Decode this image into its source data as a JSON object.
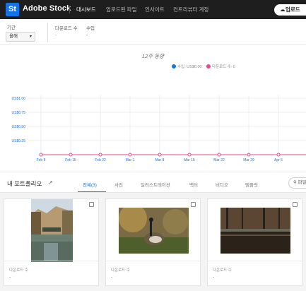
{
  "app": {
    "logo": "St",
    "brand": "Adobe Stock",
    "nav": [
      {
        "label": "대시보드",
        "active": true
      },
      {
        "label": "업로드된 파일",
        "active": false
      },
      {
        "label": "인사이트",
        "active": false
      },
      {
        "label": "컨트리뷰터 계정",
        "active": false
      }
    ],
    "upload_label": "업로드"
  },
  "filters": {
    "period_label": "기간",
    "period_value": "올해",
    "downloads_label": "다운로드 수",
    "downloads_value": "-",
    "revenue_label": "수입",
    "revenue_value": "-"
  },
  "chart_data": {
    "type": "line",
    "title": "12주 동향",
    "legend": [
      {
        "name": "수입: US$0.00",
        "color": "#1473e6"
      },
      {
        "name": "다운로드 수: 0",
        "color": "#e8488a"
      }
    ],
    "y_tick_labels": [
      "US$1.00",
      "US$0.75",
      "US$0.50",
      "US$0.25"
    ],
    "ylim": [
      0,
      1
    ],
    "categories": [
      "Feb 8",
      "Feb 15",
      "Feb 22",
      "Mar 1",
      "Mar 8",
      "Mar 15",
      "Mar 22",
      "Mar 29",
      "Apr 5",
      "Ap"
    ],
    "series": [
      {
        "name": "다운로드 수",
        "values": [
          0,
          0,
          0,
          0,
          0,
          0,
          0,
          0,
          0,
          0
        ],
        "color": "#e8488a"
      }
    ],
    "grid": true,
    "legend_position": "top"
  },
  "portfolio": {
    "title": "내 포트폴리오",
    "tabs": [
      {
        "label": "전체(3)",
        "active": true
      },
      {
        "label": "사진",
        "active": false
      },
      {
        "label": "일러스트레이션",
        "active": false
      },
      {
        "label": "벡터",
        "active": false
      },
      {
        "label": "비디오",
        "active": false
      },
      {
        "label": "템플릿",
        "active": false
      }
    ],
    "search_label": "파일",
    "cards": [
      {
        "downloads_label": "다운로드 수",
        "downloads_value": "-"
      },
      {
        "downloads_label": "다운로드 수",
        "downloads_value": "-"
      },
      {
        "downloads_label": "다운로드 수",
        "downloads_value": "-"
      }
    ]
  },
  "icons": {
    "upload": "upload-icon",
    "external": "external-link-icon",
    "search": "search-icon",
    "chevron": "chevron-down-icon"
  }
}
